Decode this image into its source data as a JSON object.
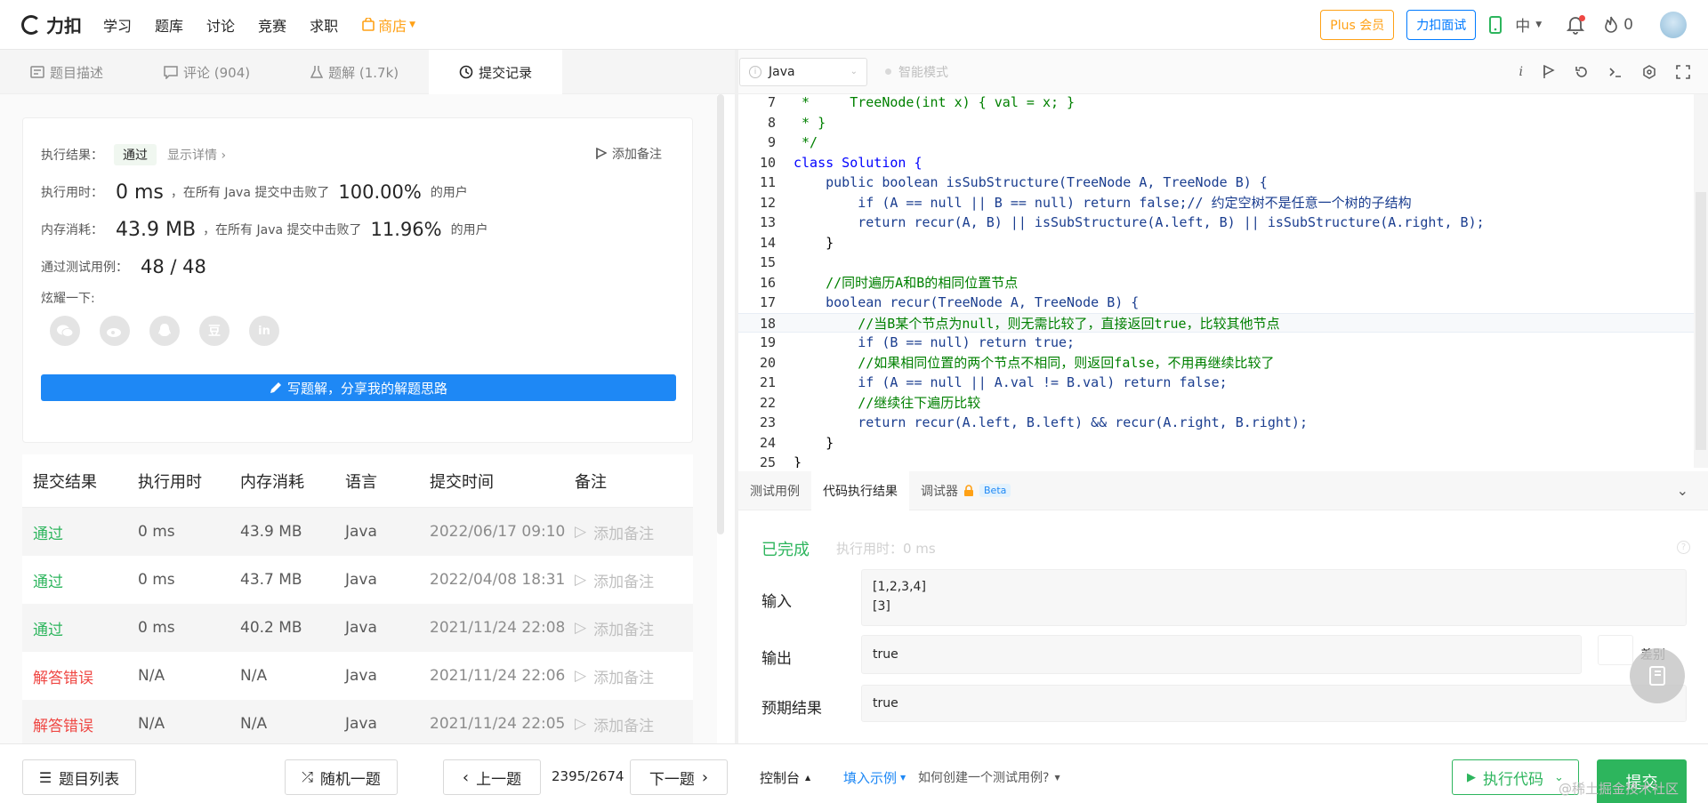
{
  "nav": {
    "logo": "力扣",
    "links": [
      "学习",
      "题库",
      "讨论",
      "竞赛",
      "求职"
    ],
    "store": "商店",
    "plus": "Plus 会员",
    "interview": "力扣面试",
    "lang": "中",
    "fire_count": "0"
  },
  "left_tabs": [
    {
      "label": "题目描述"
    },
    {
      "label": "评论 (904)"
    },
    {
      "label": "题解 (1.7k)"
    },
    {
      "label": "提交记录"
    }
  ],
  "result": {
    "result_label": "执行结果：",
    "status": "通过",
    "details": "显示详情 ›",
    "add_note": "添加备注",
    "time_label": "执行用时：",
    "time_value": "0 ms",
    "time_mid": "，在所有 Java 提交中击败了",
    "time_pct": "100.00%",
    "users": "的用户",
    "mem_label": "内存消耗：",
    "mem_value": "43.9 MB",
    "mem_mid": "，在所有 Java 提交中击败了",
    "mem_pct": "11.96%",
    "tests_label": "通过测试用例：",
    "tests_value": "48 / 48",
    "share_label": "炫耀一下:",
    "write_btn": "写题解，分享我的解题思路"
  },
  "table": {
    "headers": [
      "提交结果",
      "执行用时",
      "内存消耗",
      "语言",
      "提交时间",
      "备注"
    ],
    "rows": [
      {
        "status": "通过",
        "time": "0 ms",
        "mem": "43.9 MB",
        "lang": "Java",
        "date": "2022/06/17 09:10",
        "note": "添加备注"
      },
      {
        "status": "通过",
        "time": "0 ms",
        "mem": "43.7 MB",
        "lang": "Java",
        "date": "2022/04/08 18:31",
        "note": "添加备注"
      },
      {
        "status": "通过",
        "time": "0 ms",
        "mem": "40.2 MB",
        "lang": "Java",
        "date": "2021/11/24 22:08",
        "note": "添加备注"
      },
      {
        "status": "解答错误",
        "time": "N/A",
        "mem": "N/A",
        "lang": "Java",
        "date": "2021/11/24 22:06",
        "note": "添加备注"
      },
      {
        "status": "解答错误",
        "time": "N/A",
        "mem": "N/A",
        "lang": "Java",
        "date": "2021/11/24 22:05",
        "note": "添加备注"
      }
    ]
  },
  "editor": {
    "language": "Java",
    "smart_mode": "智能模式",
    "lines": [
      {
        "n": "7",
        "text": " *     TreeNode(int x) { val = x; }"
      },
      {
        "n": "8",
        "text": " * }"
      },
      {
        "n": "9",
        "text": " */"
      },
      {
        "n": "10",
        "text": "class Solution {"
      },
      {
        "n": "11",
        "text": "    public boolean isSubStructure(TreeNode A, TreeNode B) {"
      },
      {
        "n": "12",
        "text": "        if (A == null || B == null) return false;// 约定空树不是任意一个树的子结构"
      },
      {
        "n": "13",
        "text": "        return recur(A, B) || isSubStructure(A.left, B) || isSubStructure(A.right, B);"
      },
      {
        "n": "14",
        "text": "    }"
      },
      {
        "n": "15",
        "text": ""
      },
      {
        "n": "16",
        "text": "    //同时遍历A和B的相同位置节点"
      },
      {
        "n": "17",
        "text": "    boolean recur(TreeNode A, TreeNode B) {"
      },
      {
        "n": "18",
        "text": "        //当B某个节点为null，则无需比较了，直接返回true，比较其他节点"
      },
      {
        "n": "19",
        "text": "        if (B == null) return true;"
      },
      {
        "n": "20",
        "text": "        //如果相同位置的两个节点不相同，则返回false，不用再继续比较了"
      },
      {
        "n": "21",
        "text": "        if (A == null || A.val != B.val) return false;"
      },
      {
        "n": "22",
        "text": "        //继续往下遍历比较"
      },
      {
        "n": "23",
        "text": "        return recur(A.left, B.left) && recur(A.right, B.right);"
      },
      {
        "n": "24",
        "text": "    }"
      },
      {
        "n": "25",
        "text": "}"
      }
    ]
  },
  "console": {
    "tabs": [
      "测试用例",
      "代码执行结果",
      "调试器"
    ],
    "beta": "Beta",
    "done": "已完成",
    "exec_time": "执行用时：0 ms",
    "input_label": "输入",
    "input_line1": "[1,2,3,4]",
    "input_line2": "[3]",
    "output_label": "输出",
    "output_value": "true",
    "diff_label": "差别",
    "expected_label": "预期结果",
    "expected_value": "true"
  },
  "bottom": {
    "problem_list": "题目列表",
    "random": "随机一题",
    "prev": "上一题",
    "counter": "2395/2674",
    "next": "下一题",
    "console": "控制台",
    "fill_example": "填入示例",
    "how_to": "如何创建一个测试用例?",
    "run": "执行代码",
    "submit": "提交"
  },
  "watermark": "@稀土掘金技术社区",
  "colors": {
    "pass": "#2db55d",
    "fail": "#ef4743",
    "primary": "#1e88f5",
    "orange": "#ffa116"
  }
}
